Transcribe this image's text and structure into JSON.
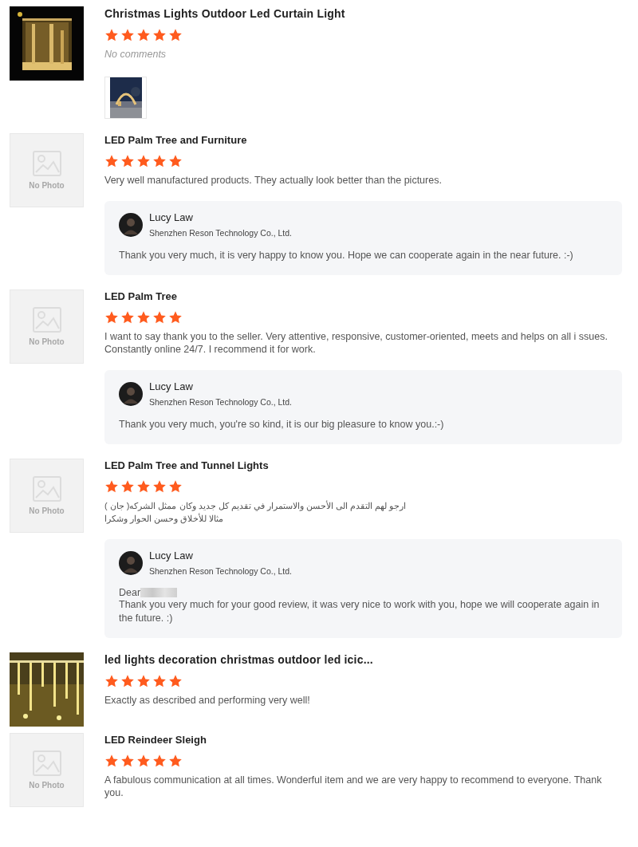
{
  "reviews": [
    {
      "title": "Christmas Lights Outdoor Led Curtain Light",
      "image": {
        "kind": "curtain"
      },
      "stars": 5,
      "comment": "No comments",
      "comment_empty": true,
      "attachments": [
        {
          "kind": "picture"
        }
      ]
    },
    {
      "title": "LED Palm Tree and Furniture",
      "image": {
        "kind": "none",
        "label": "No Photo"
      },
      "stars": 5,
      "comment": "Very well manufactured products. They actually look better than the pictures.",
      "comment_empty": false,
      "reply": {
        "name": "Lucy Law",
        "company": "Shenzhen Reson Technology Co., Ltd.",
        "message": "Thank you very much, it is very happy to know you. Hope we can cooperate again in the near future. :-)"
      }
    },
    {
      "title": "LED Palm Tree",
      "image": {
        "kind": "none",
        "label": "No Photo"
      },
      "stars": 5,
      "comment": "I want to say thank you to the seller. Very attentive, responsive, customer-oriented, meets and helps on all i ssues. Constantly online 24/7. I recommend it for work.",
      "comment_empty": false,
      "reply": {
        "name": "Lucy Law",
        "company": "Shenzhen Reson Technology Co., Ltd.",
        "message": "Thank you very much, you're so kind, it is our big pleasure to know you.:-)"
      }
    },
    {
      "title": "LED Palm Tree and Tunnel Lights",
      "image": {
        "kind": "none",
        "label": "No Photo"
      },
      "stars": 5,
      "comment": "ارجو لهم التقدم الى الأحسن  والاستمرار في تقديم  كل جديد وكان ممثل الشركه( جان )\nمثالا للأخلاق وحسن الحوار  وشكرا",
      "comment_empty": false,
      "rtl": true,
      "reply": {
        "name": "Lucy Law",
        "company": "Shenzhen Reson Technology Co., Ltd.",
        "greeting": "Dear",
        "message": "Thank you very much for your good review, it was very nice to work with you, hope we will cooperate again in the future. :)"
      }
    },
    {
      "title": "led lights decoration christmas outdoor led icic...",
      "image": {
        "kind": "icicle"
      },
      "stars": 5,
      "comment": "Exactly as described and performing very well!",
      "comment_empty": false
    },
    {
      "title": "LED Reindeer Sleigh",
      "image": {
        "kind": "none",
        "label": "No Photo"
      },
      "stars": 5,
      "comment": "A fabulous communication at all times. Wonderful item and we are very happy to recommend to everyone. Thank you.",
      "comment_empty": false
    }
  ]
}
